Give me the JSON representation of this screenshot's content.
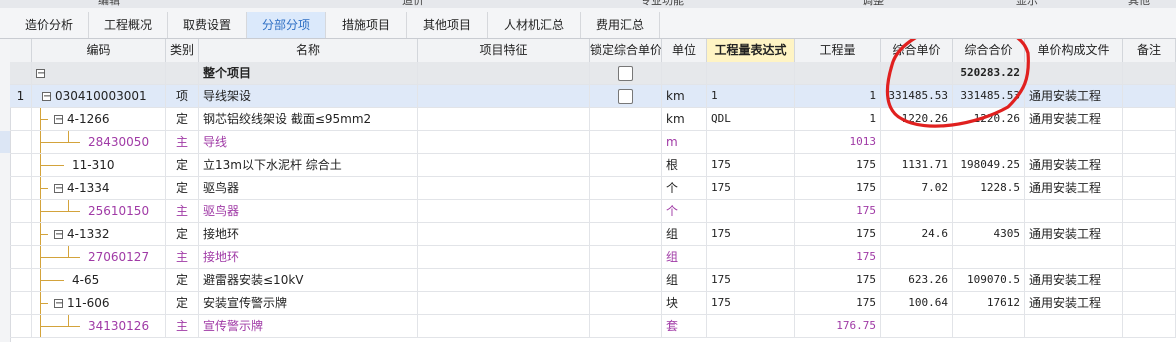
{
  "top_strip": [
    "编辑",
    "造价",
    "专业功能",
    "调整",
    "显示",
    "其他"
  ],
  "tabs": [
    {
      "label": "造价分析"
    },
    {
      "label": "工程概况"
    },
    {
      "label": "取费设置"
    },
    {
      "label": "分部分项"
    },
    {
      "label": "措施项目"
    },
    {
      "label": "其他项目"
    },
    {
      "label": "人材机汇总"
    },
    {
      "label": "费用汇总"
    }
  ],
  "active_tab": "分部分项",
  "columns": {
    "code": "编码",
    "type": "类别",
    "name": "名称",
    "feature": "项目特征",
    "lock": "锁定综合单价",
    "unit": "单位",
    "expr": "工程量表达式",
    "qty": "工程量",
    "unit_price": "综合单价",
    "total": "综合合价",
    "file": "单价构成文件",
    "note": "备注"
  },
  "summary": {
    "toggle": "−",
    "name": "整个项目",
    "total": "520283.22"
  },
  "rows": [
    {
      "num": "1",
      "toggle": "−",
      "code": "030410003001",
      "type": "项",
      "name": "导线架设",
      "unit": "km",
      "expr": "1",
      "qty": "1",
      "unit_price": "331485.53",
      "total": "331485.53",
      "file": "通用安装工程",
      "kind": "item"
    },
    {
      "toggle": "−",
      "code": "4-1266",
      "type": "定",
      "name": "钢芯铝绞线架设 截面≤95mm2",
      "unit": "km",
      "expr": "QDL",
      "qty": "1",
      "unit_price": "1220.26",
      "total": "1220.26",
      "file": "通用安装工程",
      "kind": "quota"
    },
    {
      "code": "28430050",
      "type": "主",
      "name": "导线",
      "unit": "m",
      "expr": "",
      "qty": "1013",
      "unit_price": "",
      "total": "",
      "file": "",
      "kind": "material"
    },
    {
      "code": "11-310",
      "type": "定",
      "name": "立13m以下水泥杆 综合土",
      "unit": "根",
      "expr": "175",
      "qty": "175",
      "unit_price": "1131.71",
      "total": "198049.25",
      "file": "通用安装工程",
      "kind": "quota-leaf"
    },
    {
      "toggle": "−",
      "code": "4-1334",
      "type": "定",
      "name": "驱鸟器",
      "unit": "个",
      "expr": "175",
      "qty": "175",
      "unit_price": "7.02",
      "total": "1228.5",
      "file": "通用安装工程",
      "kind": "quota"
    },
    {
      "code": "25610150",
      "type": "主",
      "name": "驱鸟器",
      "unit": "个",
      "expr": "",
      "qty": "175",
      "unit_price": "",
      "total": "",
      "file": "",
      "kind": "material"
    },
    {
      "toggle": "−",
      "code": "4-1332",
      "type": "定",
      "name": "接地环",
      "unit": "组",
      "expr": "175",
      "qty": "175",
      "unit_price": "24.6",
      "total": "4305",
      "file": "通用安装工程",
      "kind": "quota"
    },
    {
      "code": "27060127",
      "type": "主",
      "name": "接地环",
      "unit": "组",
      "expr": "",
      "qty": "175",
      "unit_price": "",
      "total": "",
      "file": "",
      "kind": "material"
    },
    {
      "code": "4-65",
      "type": "定",
      "name": "避雷器安装≤10kV",
      "unit": "组",
      "expr": "175",
      "qty": "175",
      "unit_price": "623.26",
      "total": "109070.5",
      "file": "通用安装工程",
      "kind": "quota-leaf"
    },
    {
      "toggle": "−",
      "code": "11-606",
      "type": "定",
      "name": "安装宣传警示牌",
      "unit": "块",
      "expr": "175",
      "qty": "175",
      "unit_price": "100.64",
      "total": "17612",
      "file": "通用安装工程",
      "kind": "quota"
    },
    {
      "code": "34130126",
      "type": "主",
      "name": "宣传警示牌",
      "unit": "套",
      "expr": "",
      "qty": "176.75",
      "unit_price": "",
      "total": "",
      "file": "",
      "kind": "material"
    }
  ],
  "colors": {
    "active_tab": "#2e6fc4",
    "material_text": "#a03aa6",
    "annotation": "#e0201f",
    "tree_line": "#d3a33b"
  }
}
